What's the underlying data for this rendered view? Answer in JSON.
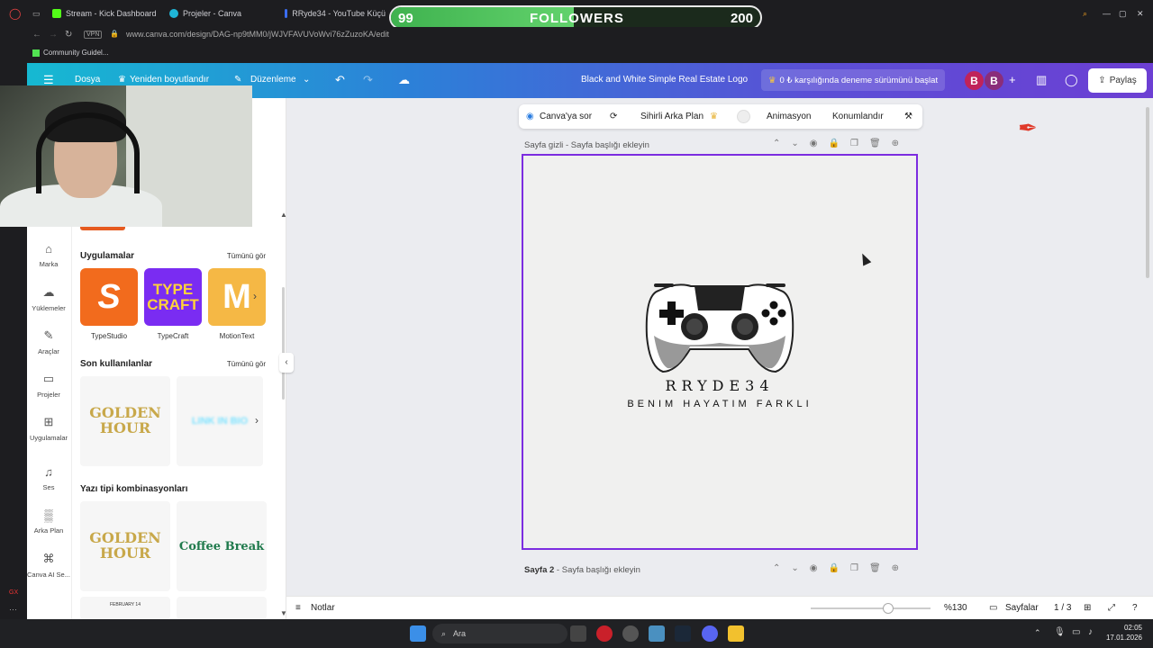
{
  "browser": {
    "tabs": [
      {
        "label": "Stream - Kick Dashboard",
        "icon": "kick-icon",
        "color": "#53fc18"
      },
      {
        "label": "Projeler - Canva",
        "icon": "canva-icon",
        "color": "#1fb6d8"
      },
      {
        "label": "RRyde34 - YouTube Küçü",
        "icon": "shield-icon",
        "color": "#3b6df0"
      }
    ],
    "url": "www.canva.com/design/DAG-np9tMM0/jWJVFAVUVoWvi76zZuzoKA/edit",
    "vpn_label": "VPN",
    "bookmark": "Community Guidel..."
  },
  "followers_overlay": {
    "current": "99",
    "label": "FOLLOWERS",
    "goal": "200",
    "progress": 0.495,
    "color": "#53d15f"
  },
  "canva_header": {
    "menu_file": "Dosya",
    "resize": "Yeniden boyutlandır",
    "edit": "Düzenleme",
    "design_title": "Black and White Simple Real Estate Logo",
    "trial_button": "0 ₺ karşılığında deneme sürümünü başlat",
    "avatars": [
      "B",
      "B"
    ],
    "share": "Paylaş"
  },
  "sidebar": {
    "items": [
      {
        "label": "Marka",
        "icon": "brand-icon"
      },
      {
        "label": "Yüklemeler",
        "icon": "upload-cloud-icon"
      },
      {
        "label": "Araçlar",
        "icon": "tools-icon"
      },
      {
        "label": "Projeler",
        "icon": "folder-icon"
      },
      {
        "label": "Uygulamalar",
        "icon": "apps-grid-icon"
      },
      {
        "label": "Ses",
        "icon": "music-icon"
      },
      {
        "label": "Arka Plan",
        "icon": "background-icon"
      },
      {
        "label": "Canva AI Se...",
        "icon": "canva-ai-icon"
      }
    ]
  },
  "panel": {
    "apps_title": "Uygulamalar",
    "see_all": "Tümünü gör",
    "apps": [
      {
        "label": "TypeStudio",
        "thumb": "S",
        "color": "#f26b1d"
      },
      {
        "label": "TypeCraft",
        "thumb": "TYPE CRAFT",
        "color": "#7a2cf2"
      },
      {
        "label": "MotionText",
        "thumb": "M",
        "color": "#f5b845"
      }
    ],
    "recent_title": "Son kullanılanlar",
    "recent_see_all": "Tümünü gör",
    "recent": [
      {
        "text": "GOLDEN HOUR"
      },
      {
        "text": "LINK IN BIO"
      }
    ],
    "font_combos_title": "Yazı tipi kombinasyonları",
    "font_combos": [
      {
        "text": "GOLDEN HOUR"
      },
      {
        "text": "Coffee Break"
      }
    ],
    "partial_card": "FEBRUARY 14"
  },
  "floating_toolbar": {
    "ask_canva": "Canva'ya sor",
    "magic_bg": "Sihirli Arka Plan",
    "animation": "Animasyon",
    "position": "Konumlandır"
  },
  "pages": {
    "page1_header": "Sayfa gizli",
    "page1_title_prompt": "Sayfa başlığı ekleyin",
    "page2_label": "Sayfa 2",
    "page2_title_prompt": "Sayfa başlığı ekleyin"
  },
  "design": {
    "title": "RRYDE34",
    "subtitle": "BENIM HAYATIM FARKLI"
  },
  "bottom_bar": {
    "notes": "Notlar",
    "zoom": "%130",
    "zoom_slider": 0.65,
    "pages_label": "Sayfalar",
    "page_count": "1 / 3"
  },
  "taskbar": {
    "search": "Ara",
    "time": "02:05",
    "date": "17.01.2026"
  }
}
